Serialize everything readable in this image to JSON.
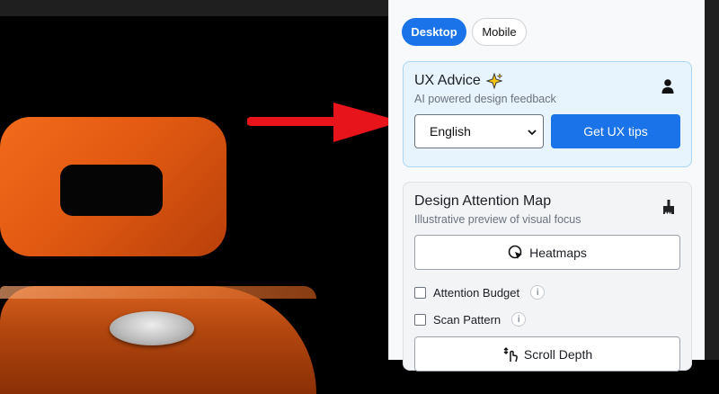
{
  "view_toggle": {
    "desktop_label": "Desktop",
    "mobile_label": "Mobile"
  },
  "ux_advice": {
    "title": "UX Advice",
    "title_icon": "sparkles-icon",
    "subtitle": "AI powered design feedback",
    "person_icon": "person-icon",
    "language_select": {
      "selected": "English"
    },
    "get_tips_label": "Get UX tips"
  },
  "attention_map": {
    "title": "Design Attention Map",
    "subtitle": "Illustrative preview of visual focus",
    "brush_icon": "brush-icon",
    "heatmaps_label": "Heatmaps",
    "options": [
      {
        "label": "Attention Budget",
        "checked": false,
        "info": "i"
      },
      {
        "label": "Scan Pattern",
        "checked": false,
        "info": "i"
      }
    ],
    "scroll_depth_label": "Scroll Depth"
  },
  "colors": {
    "accent": "#1a73e8",
    "arrow": "#e8141c",
    "product_orange": "#f26a1b"
  }
}
